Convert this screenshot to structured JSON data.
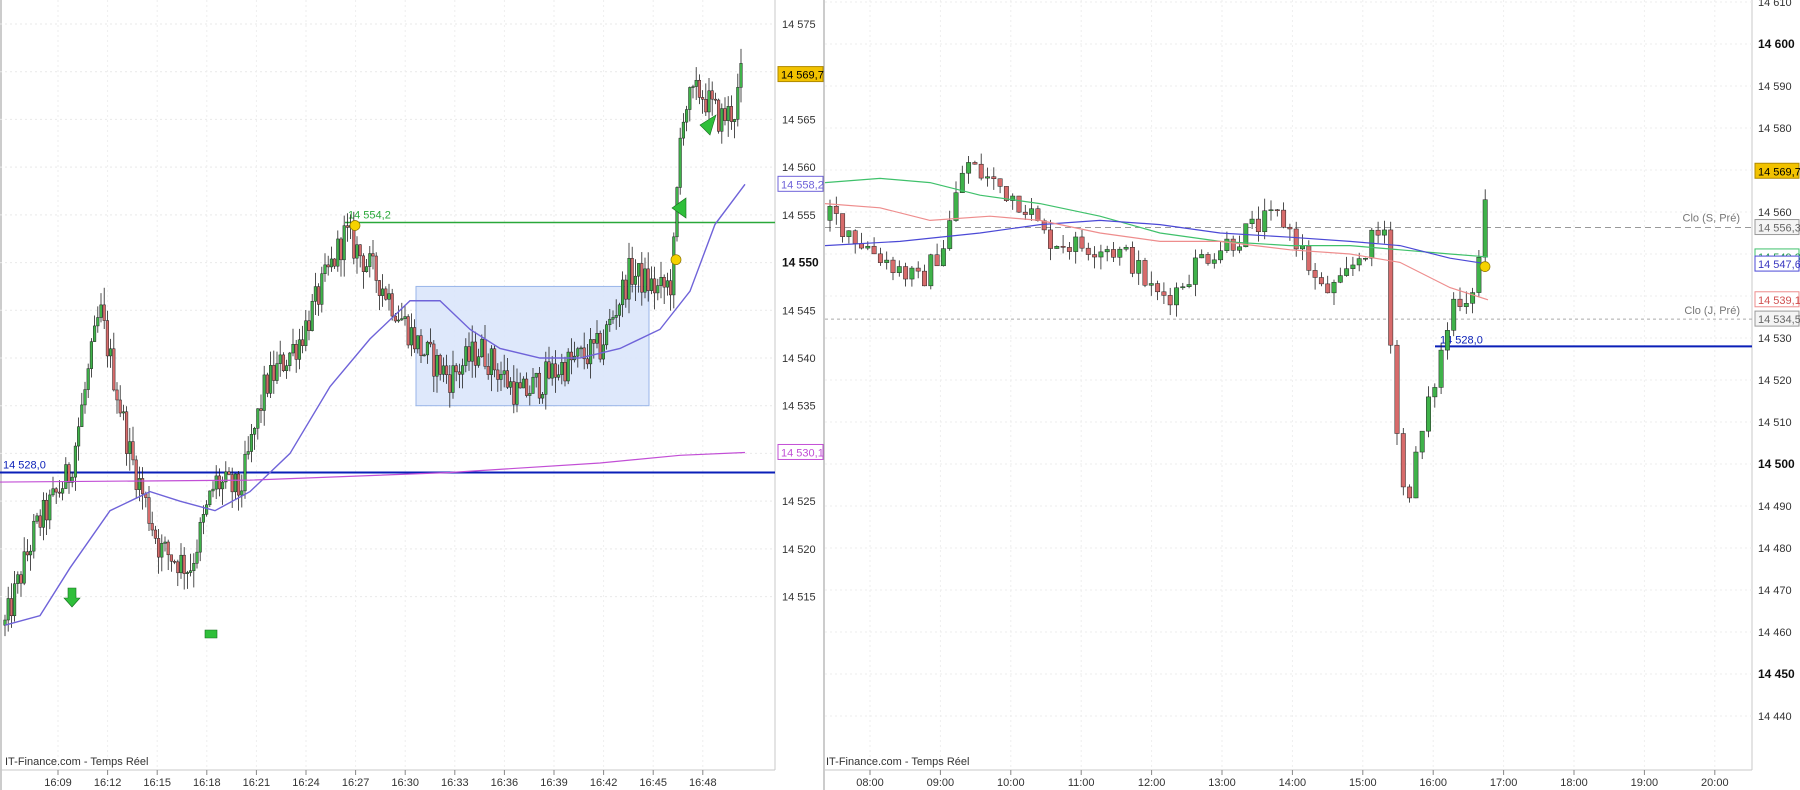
{
  "left_chart": {
    "watermark": "IT-Finance.com - Temps Réel",
    "y_ticks": [
      "14 575",
      "14 570",
      "14 565",
      "14 560",
      "14 555",
      "14 550",
      "14 545",
      "14 540",
      "14 535",
      "14 530",
      "14 525",
      "14 520",
      "14 515"
    ],
    "x_ticks": [
      "16:09",
      "16:12",
      "16:15",
      "16:18",
      "16:21",
      "16:24",
      "16:27",
      "16:30",
      "16:33",
      "16:36",
      "16:39",
      "16:42",
      "16:45",
      "16:48"
    ],
    "price_badge": "14 569,7",
    "ma_blue_badge": "14 558,2",
    "ma_purple_badge": "14 530,1",
    "line_green_label": "14 554,2",
    "line_blue_label": "14 528,0",
    "colors": {
      "up": "#3fb24a",
      "down": "#d76b6b",
      "blue_line": "#0a1fb8",
      "green_line": "#2aa83a",
      "ma_blue": "#6f63d9",
      "ma_purple": "#c24fd6",
      "box": "#dbe6fb",
      "badge_yellow": "#f2c200"
    }
  },
  "right_chart": {
    "watermark": "IT-Finance.com - Temps Réel",
    "y_ticks": [
      "14 610",
      "14 600",
      "14 590",
      "14 580",
      "14 570",
      "14 560",
      "14 550",
      "14 540",
      "14 530",
      "14 520",
      "14 510",
      "14 500",
      "14 490",
      "14 480",
      "14 470",
      "14 460",
      "14 450",
      "14 440"
    ],
    "y_bold": [
      "14 600",
      "14 550",
      "14 500",
      "14 450"
    ],
    "x_ticks": [
      "08:00",
      "09:00",
      "10:00",
      "11:00",
      "12:00",
      "13:00",
      "14:00",
      "15:00",
      "16:00",
      "17:00",
      "18:00",
      "19:00",
      "20:00"
    ],
    "price_badge": "14 569,7",
    "ref_s_label": "Clo (S, Pré)",
    "ref_s_badge": "14 556,3",
    "ref_j_label": "Clo (J, Pré)",
    "ref_j_badge": "14 534,5",
    "green_ma_badge": "14 549,3",
    "blue_ma_badge": "14 547,6",
    "red_ma_badge": "14 539,1",
    "line_blue_label": "14 528,0"
  },
  "chart_data": [
    {
      "type": "candlestick",
      "title": "",
      "timeframe": "intraday short",
      "x": [
        "16:09",
        "16:12",
        "16:15",
        "16:18",
        "16:21",
        "16:24",
        "16:27",
        "16:30",
        "16:33",
        "16:36",
        "16:39",
        "16:42",
        "16:45",
        "16:48"
      ],
      "approx_close_path": [
        14513,
        14540,
        14520,
        14522,
        14538,
        14553,
        14546,
        14538,
        14536,
        14540,
        14538,
        14545,
        14565,
        14569.7
      ],
      "ylim": [
        14510,
        14577
      ],
      "horizontal_levels": [
        {
          "name": "",
          "value": 14554.2
        },
        {
          "name": "",
          "value": 14528.0
        }
      ],
      "consolidation_box": {
        "y_low": 14535,
        "y_high": 14547.5,
        "x_from": "16:28",
        "x_to": "16:42"
      },
      "last_price": 14569.7
    },
    {
      "type": "candlestick",
      "title": "",
      "timeframe": "intraday 15min",
      "x": [
        "08:00",
        "09:00",
        "10:00",
        "11:00",
        "12:00",
        "13:00",
        "14:00",
        "15:00",
        "16:00",
        "17:00",
        "18:00",
        "19:00",
        "20:00"
      ],
      "approx_close_path": [
        14557,
        14549,
        14567,
        14553,
        14548,
        14553,
        14560,
        14548,
        14497,
        14569.7
      ],
      "ylim": [
        14435,
        14612
      ],
      "reference_levels": [
        {
          "name": "Clo (S, Pré)",
          "value": 14556.3
        },
        {
          "name": "Clo (J, Pré)",
          "value": 14534.5
        },
        {
          "name": "",
          "value": 14528.0
        }
      ],
      "ma_values": [
        14549.3,
        14547.6,
        14539.1
      ],
      "last_price": 14569.7
    }
  ]
}
